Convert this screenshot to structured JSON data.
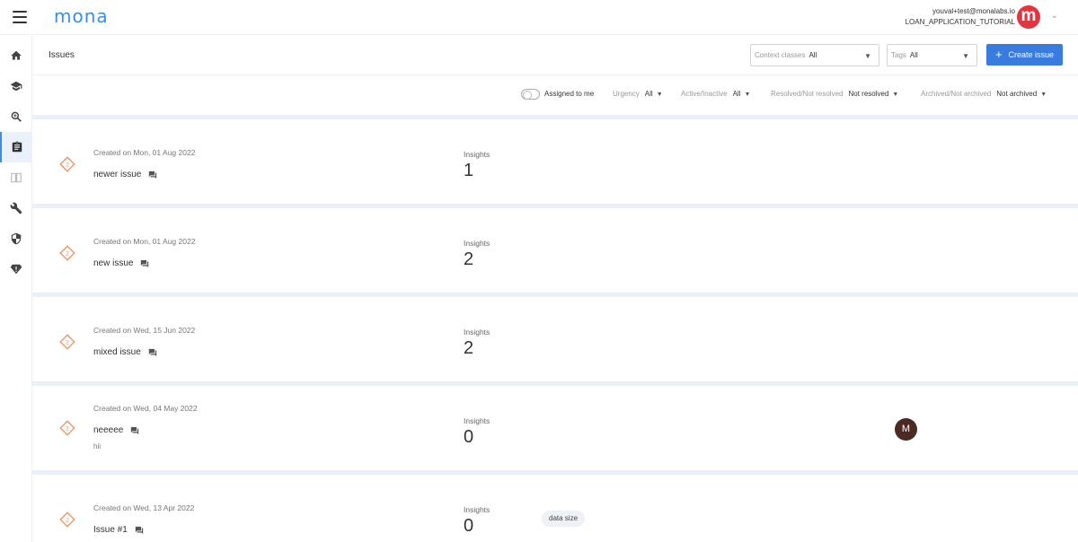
{
  "app": {
    "logo": "mona"
  },
  "account": {
    "email": "youval+test@monalabs.io",
    "workspace": "LOAN_APPLICATION_TUTORIAL",
    "avatar_letter": "m"
  },
  "sidebar": {
    "items": [
      {
        "icon": "home-icon"
      },
      {
        "icon": "graduation-cap-icon"
      },
      {
        "icon": "search-icon"
      },
      {
        "icon": "clipboard-icon",
        "active": true
      },
      {
        "icon": "book-icon"
      },
      {
        "icon": "wrench-icon"
      },
      {
        "icon": "shield-icon"
      },
      {
        "icon": "warning-diamond-icon"
      }
    ]
  },
  "header": {
    "title": "Issues",
    "context_classes": {
      "label": "Context classes",
      "value": "All"
    },
    "tags": {
      "label": "Tags",
      "value": "All"
    },
    "create_button": "Create issue"
  },
  "filters": {
    "assigned_label": "Assigned to me",
    "urgency": {
      "label": "Urgency",
      "value": "All"
    },
    "active": {
      "label": "Active/Inactive",
      "value": "All"
    },
    "resolved": {
      "label": "Resolved/Not resolved",
      "value": "Not resolved"
    },
    "archived": {
      "label": "Archived/Not archived",
      "value": "Not archived"
    }
  },
  "issues": [
    {
      "urgency": "2",
      "created": "Created on Mon, 01 Aug 2022",
      "title": "newer issue",
      "subtitle": "",
      "insights_label": "Insights",
      "insights": "1",
      "tag": "",
      "assignee": ""
    },
    {
      "urgency": "2",
      "created": "Created on Mon, 01 Aug 2022",
      "title": "new issue",
      "subtitle": "",
      "insights_label": "Insights",
      "insights": "2",
      "tag": "",
      "assignee": ""
    },
    {
      "urgency": "2",
      "created": "Created on Wed, 15 Jun 2022",
      "title": "mixed issue",
      "subtitle": "",
      "insights_label": "Insights",
      "insights": "2",
      "tag": "",
      "assignee": ""
    },
    {
      "urgency": "2",
      "created": "Created on Wed, 04 May 2022",
      "title": "neeeee",
      "subtitle": "hii",
      "insights_label": "Insights",
      "insights": "0",
      "tag": "",
      "assignee": "M"
    },
    {
      "urgency": "2",
      "created": "Created on Wed, 13 Apr 2022",
      "title": "Issue #1",
      "subtitle": "",
      "insights_label": "Insights",
      "insights": "0",
      "tag": "data size",
      "assignee": ""
    }
  ]
}
